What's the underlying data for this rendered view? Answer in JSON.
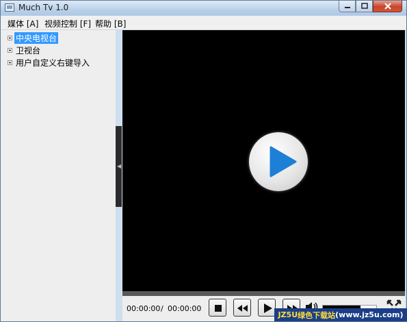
{
  "window": {
    "title": "Much Tv 1.0",
    "buttons": [
      "minimize",
      "maximize",
      "close"
    ]
  },
  "menubar": {
    "items": [
      "媒体 [A]",
      "视频控制 [F]",
      "帮助 [B]"
    ]
  },
  "sidebar": {
    "items": [
      {
        "label": "中央电视台",
        "selected": true
      },
      {
        "label": "卫视台",
        "selected": false
      },
      {
        "label": "用户自定义右键导入",
        "selected": false
      }
    ]
  },
  "player": {
    "current_time": "00:00:00",
    "separator": "/",
    "total_time": "00:00:00",
    "volume": 0.7,
    "icons": [
      "play-big-icon",
      "stop-icon",
      "rewind-icon",
      "play-icon",
      "fast-forward-icon",
      "volume-icon",
      "fullscreen-icon"
    ]
  },
  "watermark": {
    "prefix": "JZ5U",
    "text": "绿色下载站",
    "url": "(www.jz5u.com)"
  },
  "colors": {
    "selection": "#3399ff",
    "video_bg": "#000000",
    "accent_play": "#1e7fd6"
  }
}
